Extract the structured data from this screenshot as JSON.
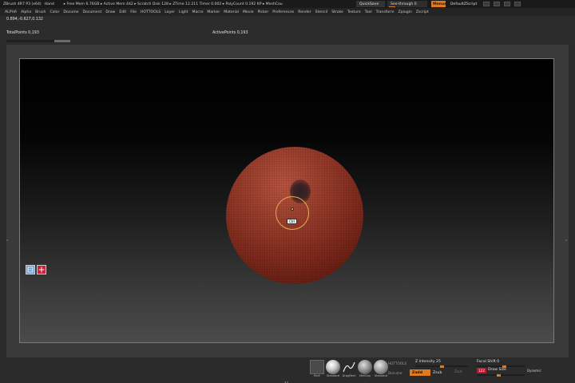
{
  "titlebar": {
    "app_title": "ZBrush 4R7 P3 (x64)",
    "user": "Hand",
    "stats": "▸ Free Mem 6.76GB ▸ Active Mem 442 ▸ Scratch Disk 128 ▸ ZTime 12.211 Timer 0.002 ▸ PolyCount 0.192 KP ▸ MeshCou",
    "quicksave": "QuickSave",
    "seethrough": "See-through 0",
    "menus": "Menus",
    "default_script": "DefaultZScript"
  },
  "menubar": {
    "items": [
      "ALPHA",
      "Alpha",
      "Brush",
      "Color",
      "Docume",
      "Document",
      "Draw",
      "Edit",
      "File",
      "HOTTOOLS",
      "Layer",
      "Light",
      "Macro",
      "Marker",
      "Material",
      "Movie",
      "Picker",
      "Preferences",
      "Render",
      "Stencil",
      "Stroke",
      "Texture",
      "Tool",
      "Transform",
      "Zplugin",
      "Zscript"
    ]
  },
  "info": {
    "coords": "0.894,-0.627,0.132",
    "total_points": "TotalPoints 0,193",
    "active_points": "ActivePoints 0,193"
  },
  "canvas": {
    "ctrl_label": "Ctrl"
  },
  "shelf": {
    "tools": [
      {
        "label": "Rect"
      },
      {
        "label": "Standard"
      },
      {
        "label": "DragRect"
      },
      {
        "label": "MatCap"
      },
      {
        "label": "Standard"
      }
    ],
    "mrgb": "HOTTOOLS",
    "rgb": "Docume",
    "zadd": "Zadd",
    "zsub": "Zsub",
    "zcut": "Zcut",
    "z_intensity": "Z Intensity 25",
    "z_intensity_level": 0.5,
    "focal_shift": "Focal Shift 0",
    "focal_shift_level": 0.58,
    "rgb_intensity": "122",
    "draw_size": "Draw Size",
    "draw_size_level": 0.45,
    "dynamic": "Dynamic"
  },
  "colors": {
    "accent": "#e07a1e",
    "sphere": "#9a3e2d",
    "brush_ring": "#e3b24a"
  }
}
